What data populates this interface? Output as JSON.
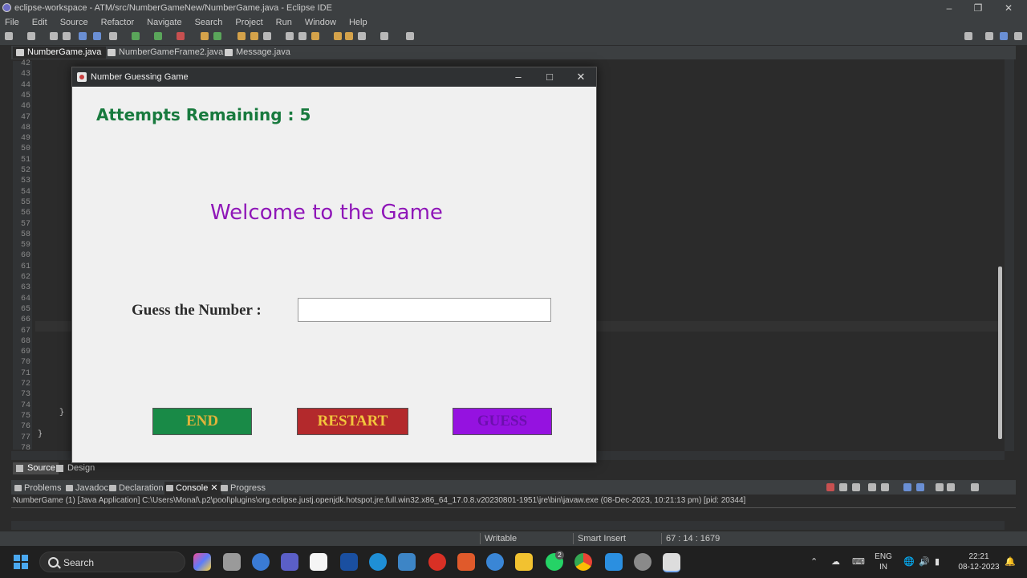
{
  "ide": {
    "title": "eclipse-workspace - ATM/src/NumberGameNew/NumberGame.java - Eclipse IDE",
    "menu": [
      "File",
      "Edit",
      "Source",
      "Refactor",
      "Navigate",
      "Search",
      "Project",
      "Run",
      "Window",
      "Help"
    ],
    "editor_tabs": [
      {
        "label": "NumberGame.java",
        "active": true
      },
      {
        "label": "NumberGameFrame2.java",
        "active": false
      },
      {
        "label": "Message.java",
        "active": false
      }
    ],
    "line_numbers": [
      "42",
      "43",
      "44",
      "45",
      "46",
      "47",
      "48",
      "49",
      "50",
      "51",
      "52",
      "53",
      "54",
      "55",
      "56",
      "57",
      "58",
      "59",
      "60",
      "61",
      "62",
      "63",
      "64",
      "65",
      "66",
      "67",
      "68",
      "69",
      "70",
      "71",
      "72",
      "73",
      "74",
      "75",
      "76",
      "77",
      "78"
    ],
    "code": {
      "line75": "}",
      "line77": "}"
    },
    "source_tabs": [
      "Source",
      "Design"
    ],
    "panel_tabs": [
      "Problems",
      "Javadoc",
      "Declaration",
      "Console",
      "Progress"
    ],
    "console_header": "NumberGame (1) [Java Application] C:\\Users\\Monal\\.p2\\pool\\plugins\\org.eclipse.justj.openjdk.hotspot.jre.full.win32.x86_64_17.0.8.v20230801-1951\\jre\\bin\\javaw.exe  (08-Dec-2023, 10:21:13 pm) [pid: 20344]",
    "status": {
      "writable": "Writable",
      "insert_mode": "Smart Insert",
      "position": "67 : 14 : 1679"
    }
  },
  "dialog": {
    "title": "Number Guessing Game",
    "attempts_label": "Attempts Remaining : 5",
    "welcome": "Welcome to the Game",
    "guess_label": "Guess the Number :",
    "guess_value": "",
    "buttons": {
      "end": "END",
      "restart": "RESTART",
      "guess": "GUESS"
    },
    "colors": {
      "attempts": "#187a3e",
      "welcome": "#8f17b8",
      "end_bg": "#198a47",
      "restart_bg": "#b3292c",
      "guess_bg": "#9512e0"
    }
  },
  "taskbar": {
    "search_label": "Search",
    "language": "ENG",
    "region": "IN",
    "time": "22:21",
    "date": "08-12-2023",
    "whatsapp_badge": "2"
  }
}
